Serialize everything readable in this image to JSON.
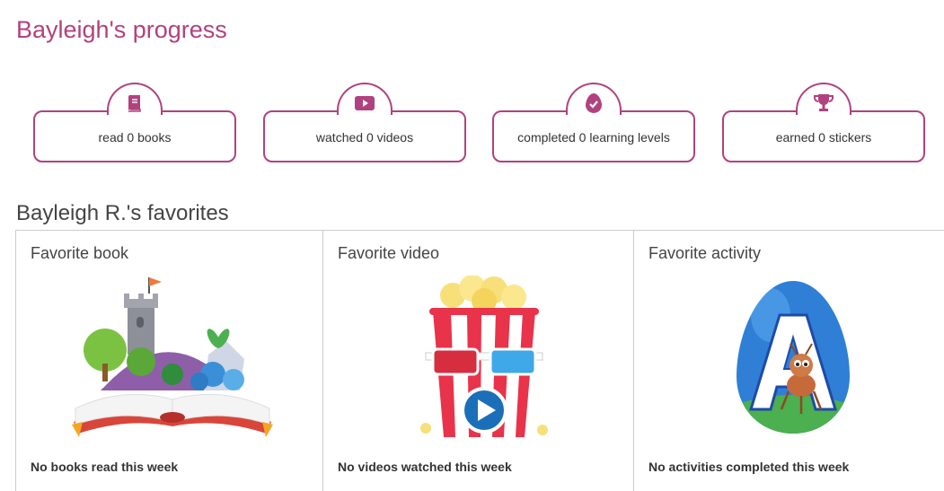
{
  "page": {
    "title": "Bayleigh's progress"
  },
  "stats": [
    {
      "label": "read 0 books",
      "icon": "book-icon"
    },
    {
      "label": "watched 0 videos",
      "icon": "video-play-icon"
    },
    {
      "label": "completed 0 learning levels",
      "icon": "egg-check-icon"
    },
    {
      "label": "earned 0 stickers",
      "icon": "trophy-icon"
    }
  ],
  "favorites": {
    "title": "Bayleigh R.'s favorites",
    "items": [
      {
        "heading": "Favorite book",
        "note": "No books read this week",
        "art": "open-book-castle-illustration"
      },
      {
        "heading": "Favorite video",
        "note": "No videos watched this week",
        "art": "popcorn-3d-glasses-illustration"
      },
      {
        "heading": "Favorite activity",
        "note": "No activities completed this week",
        "art": "letter-a-ant-egg-illustration"
      }
    ]
  },
  "colors": {
    "accent": "#b0427f",
    "text": "#333333",
    "border": "#cccccc"
  }
}
